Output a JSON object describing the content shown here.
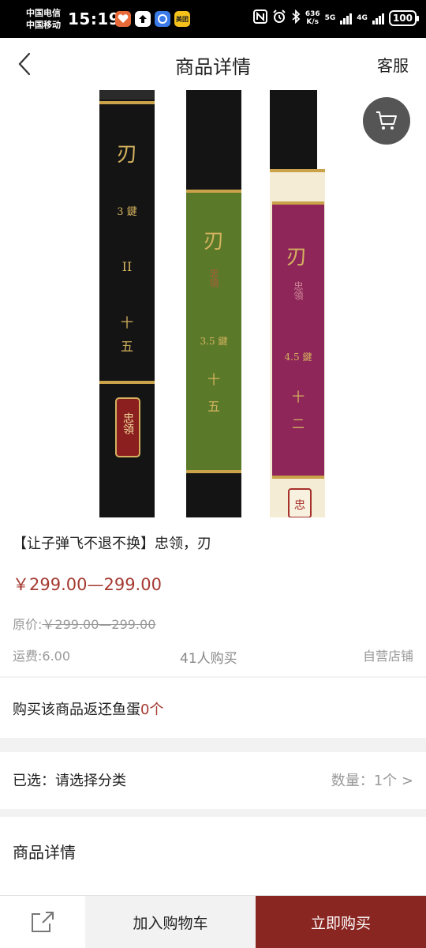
{
  "status_bar": {
    "carrier_1": "中国电信",
    "carrier_2": "中国移动",
    "time": "15:19",
    "app_badge_label": "美团",
    "net_speed_value": "636",
    "net_speed_unit": "K/s",
    "net_gen_1": "5G",
    "net_gen_2": "4G",
    "battery": "100",
    "icons": [
      "pinduoduo-icon",
      "upload-icon",
      "browser-icon",
      "meituan-icon",
      "nfc-icon",
      "alarm-icon",
      "bluetooth-icon",
      "signal-icon",
      "battery-icon"
    ]
  },
  "header": {
    "title": "商品详情",
    "service_label": "客服"
  },
  "product": {
    "image_texts": {
      "rod_1_brand": "刃",
      "rod_1_spec": "3 鍵",
      "rod_1_grade": "II",
      "rod_1_num_1": "十",
      "rod_1_num_2": "五",
      "rod_1_seal": "忠領",
      "rod_2_brand": "刃",
      "rod_2_seal": "忠領",
      "rod_2_spec": "3.5 鍵",
      "rod_2_num_1": "十",
      "rod_2_num_2": "五",
      "rod_3_brand": "刃",
      "rod_3_seal": "忠領",
      "rod_3_spec": "4.5 鍵",
      "rod_3_num_1": "十",
      "rod_3_num_2": "二",
      "rod_3_seal_bottom": "忠"
    },
    "name": "【让子弹飞不退不换】忠领，刃",
    "price": "￥299.00—299.00",
    "original_price_label": "原价:",
    "original_price": "￥299.00—299.00",
    "shipping": "运费:6.00",
    "buyers": "41人购买",
    "store_type": "自营店铺",
    "rebate_prefix": "购买该商品返还鱼蛋",
    "rebate_count": "0个",
    "selected_label": "已选：请选择分类",
    "quantity_label": "数量：1个 >",
    "details_title": "商品详情"
  },
  "bottom_bar": {
    "add_to_cart": "加入购物车",
    "buy_now": "立即购买"
  },
  "colors": {
    "price_red": "#a53a32",
    "buy_button": "#8a2621",
    "rod_green": "#5a7a2a",
    "rod_magenta": "#8e2659"
  }
}
